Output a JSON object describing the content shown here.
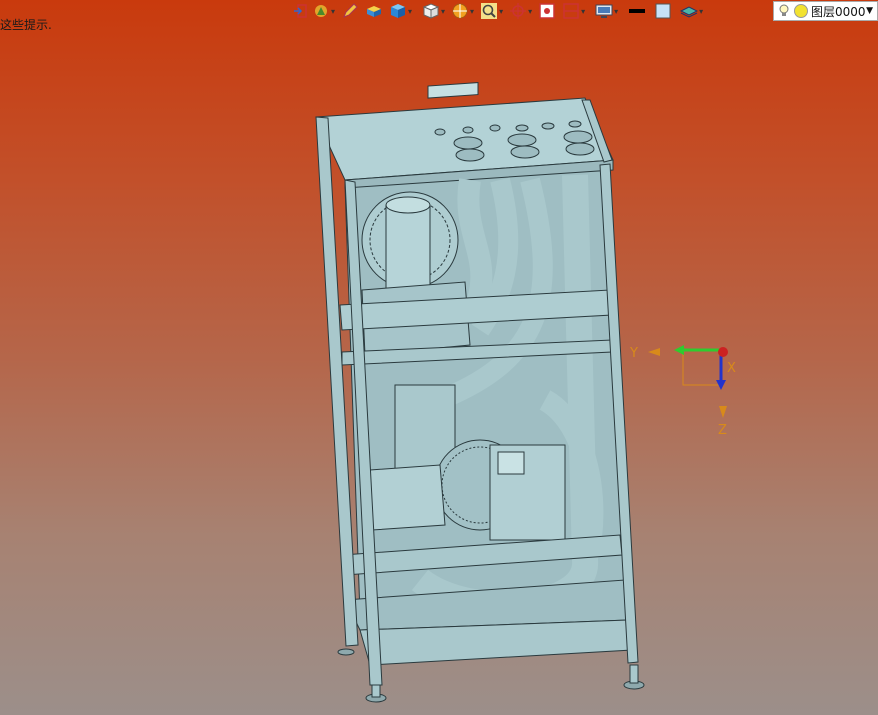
{
  "hint_text": "这些提示.",
  "toolbar": {
    "items": [
      {
        "icon": "exit-sketch-icon",
        "dropdown": false
      },
      {
        "icon": "filter-icon",
        "dropdown": true
      },
      {
        "icon": "pencil-icon",
        "dropdown": false
      },
      {
        "icon": "box-stack-icon",
        "dropdown": false
      },
      {
        "icon": "shaded-cube-icon",
        "dropdown": true
      },
      {
        "icon": "view-cube-icon",
        "dropdown": true
      },
      {
        "icon": "render-mode-icon",
        "dropdown": true
      },
      {
        "icon": "zoom-icon",
        "dropdown": true
      },
      {
        "icon": "snap-icon",
        "dropdown": true
      },
      {
        "icon": "section-icon",
        "dropdown": false
      },
      {
        "icon": "layout-icon",
        "dropdown": true
      },
      {
        "icon": "display-icon",
        "dropdown": true
      },
      {
        "icon": "line-color-icon",
        "dropdown": false
      },
      {
        "icon": "fill-color-icon",
        "dropdown": false
      },
      {
        "icon": "layer-stack-icon",
        "dropdown": true
      }
    ]
  },
  "layer_selector": {
    "value": "图层0000",
    "icon": "lightbulb-icon"
  },
  "triad": {
    "y_label": "Y",
    "x_label": "X",
    "z_label": "Z"
  },
  "colors": {
    "model": "#a9c8cc",
    "model_edge": "#2a3a3e",
    "axis_y": "#2ecc2e",
    "axis_z": "#2233cc",
    "axis_x": "#cc2222"
  }
}
